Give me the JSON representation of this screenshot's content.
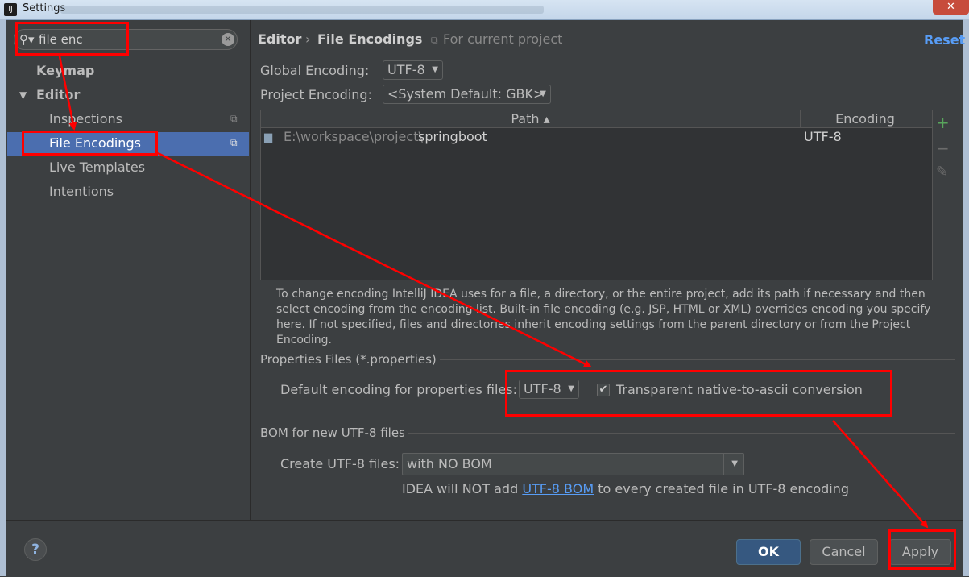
{
  "window": {
    "title": "Settings",
    "app_icon": "IJ",
    "close_glyph": "✕"
  },
  "search": {
    "value": "file enc",
    "icon": "search-icon",
    "clear_glyph": "✕"
  },
  "sidebar": {
    "items": [
      {
        "label": "Keymap",
        "bold": true
      },
      {
        "label": "Editor",
        "bold": true,
        "expanded": true
      },
      {
        "label": "Inspections"
      },
      {
        "label": "File Encodings",
        "selected": true
      },
      {
        "label": "Live Templates"
      },
      {
        "label": "Intentions"
      }
    ]
  },
  "breadcrumb": {
    "parent": "Editor",
    "separator": "›",
    "current": "File Encodings",
    "scope": "For current project"
  },
  "reset_label": "Reset",
  "global_encoding": {
    "label": "Global Encoding:",
    "value": "UTF-8"
  },
  "project_encoding": {
    "label": "Project Encoding:",
    "value": "<System Default: GBK>"
  },
  "table": {
    "headers": {
      "path": "Path ▴",
      "encoding": "Encoding"
    },
    "rows": [
      {
        "path_prefix": "E:\\workspace\\project\\",
        "path_name": "springboot",
        "encoding": "UTF-8"
      }
    ],
    "tools": {
      "add": "+",
      "remove": "−",
      "edit": "✎"
    }
  },
  "help_text": "To change encoding IntelliJ IDEA uses for a file, a directory, or the entire project, add its path if necessary and then select encoding from the encoding list. Built-in file encoding (e.g. JSP, HTML or XML) overrides encoding you specify here. If not specified, files and directories inherit encoding settings from the parent directory or from the Project Encoding.",
  "properties": {
    "section_title": "Properties Files (*.properties)",
    "default_label": "Default encoding for properties files:",
    "default_value": "UTF-8",
    "transparent_label": "Transparent native-to-ascii conversion",
    "transparent_checked": true,
    "check_glyph": "✔"
  },
  "bom": {
    "section_title": "BOM for new UTF-8 files",
    "create_label": "Create UTF-8 files:",
    "create_value": "with NO BOM",
    "note_prefix": "IDEA will NOT add ",
    "note_link": "UTF-8 BOM",
    "note_suffix": " to every created file in UTF-8 encoding"
  },
  "buttons": {
    "help": "?",
    "ok": "OK",
    "cancel": "Cancel",
    "apply": "Apply"
  },
  "colors": {
    "background": "#3c3f41",
    "selection": "#4b6eaf",
    "link": "#589df6",
    "annotation": "#ff0000"
  }
}
